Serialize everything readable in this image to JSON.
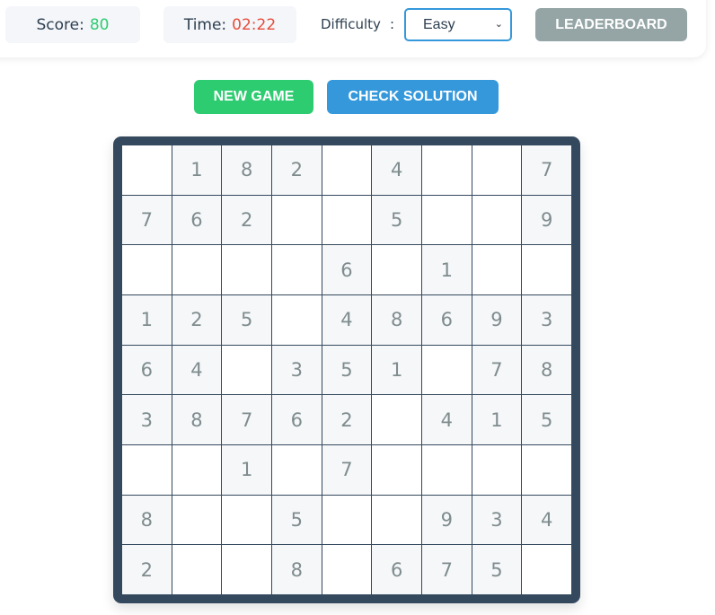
{
  "header": {
    "score_label": "Score:",
    "score_value": "80",
    "time_label": "Time:",
    "time_value": "02:22",
    "difficulty_label": "Difficulty",
    "difficulty_colon": ":",
    "difficulty_selected": "Easy",
    "leaderboard_label": "LEADERBOARD"
  },
  "controls": {
    "new_game_label": "NEW GAME",
    "check_solution_label": "CHECK SOLUTION"
  },
  "colors": {
    "score": "#2ecc71",
    "time": "#e74c3c",
    "board_border": "#34495e",
    "new_game": "#2ecc71",
    "check_solution": "#3498db",
    "leaderboard": "#95a5a6"
  },
  "board": [
    [
      "",
      "1",
      "8",
      "2",
      "",
      "4",
      "",
      "",
      "7"
    ],
    [
      "7",
      "6",
      "2",
      "",
      "",
      "5",
      "",
      "",
      "9"
    ],
    [
      "",
      "",
      "",
      "",
      "6",
      "",
      "1",
      "",
      ""
    ],
    [
      "1",
      "2",
      "5",
      "",
      "4",
      "8",
      "6",
      "9",
      "3"
    ],
    [
      "6",
      "4",
      "",
      "3",
      "5",
      "1",
      "",
      "7",
      "8"
    ],
    [
      "3",
      "8",
      "7",
      "6",
      "2",
      "",
      "4",
      "1",
      "5"
    ],
    [
      "",
      "",
      "1",
      "",
      "7",
      "",
      "",
      "",
      ""
    ],
    [
      "8",
      "",
      "",
      "5",
      "",
      "",
      "9",
      "3",
      "4"
    ],
    [
      "2",
      "",
      "",
      "8",
      "",
      "6",
      "7",
      "5",
      ""
    ]
  ]
}
